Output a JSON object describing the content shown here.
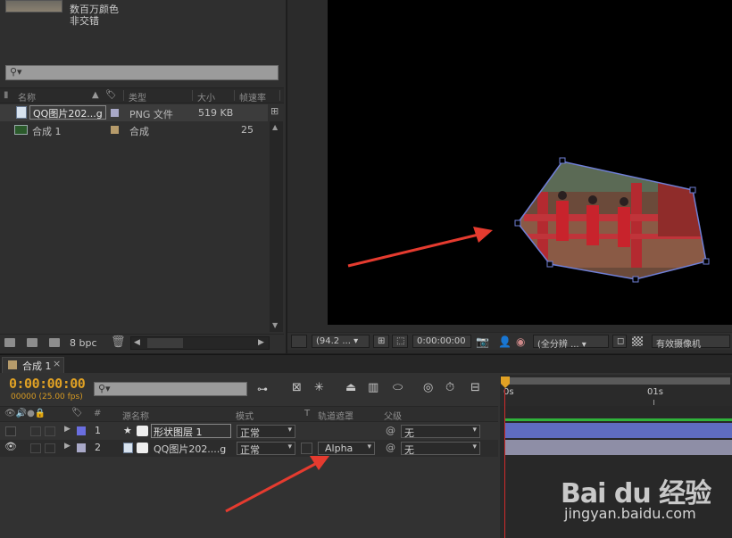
{
  "project": {
    "info_line1": "数百万颜色",
    "info_line2": "非交错",
    "columns": {
      "name": "名称",
      "type": "类型",
      "size": "大小",
      "rate": "帧速率"
    },
    "items": [
      {
        "name": "QQ图片202...g",
        "type": "PNG 文件",
        "size": "519 KB",
        "rate": "",
        "label_color": "#a9a9c8"
      },
      {
        "name": "合成 1",
        "type": "合成",
        "size": "",
        "rate": "25",
        "label_color": "#b69b6b"
      }
    ],
    "footer_bpc": "8 bpc"
  },
  "viewer": {
    "zoom": "(94.2 ...",
    "timecode": "0:00:00:00",
    "resolution": "(全分辨 ...",
    "camera": "有效摄像机"
  },
  "timeline": {
    "tab_label": "合成 1",
    "timecode": "0:00:00:00",
    "fps_line": "00000 (25.00 fps)",
    "columns": {
      "hash": "#",
      "source": "源名称",
      "mode": "模式",
      "t": "T",
      "trkmat": "轨道遮罩",
      "parent": "父级"
    },
    "ruler": {
      "start": "0s",
      "mark1": "01s"
    },
    "layers": [
      {
        "num": "1",
        "name": "形状图层 1",
        "mode": "正常",
        "trkmat": "",
        "parent": "无",
        "label_color": "#6a6ee0",
        "bar_color": "#5f6cc0"
      },
      {
        "num": "2",
        "name": "QQ图片202....g",
        "mode": "正常",
        "trkmat": "Alpha",
        "parent": "无",
        "label_color": "#a9a9c8",
        "bar_color": "#8e8ea6"
      }
    ]
  },
  "watermark": {
    "logo": "Bai du 经验",
    "url": "jingyan.baidu.com"
  },
  "colors": {
    "accent_time": "#e0a124",
    "arrow": "#e53b2f",
    "timeline_green": "#2fb23a"
  }
}
